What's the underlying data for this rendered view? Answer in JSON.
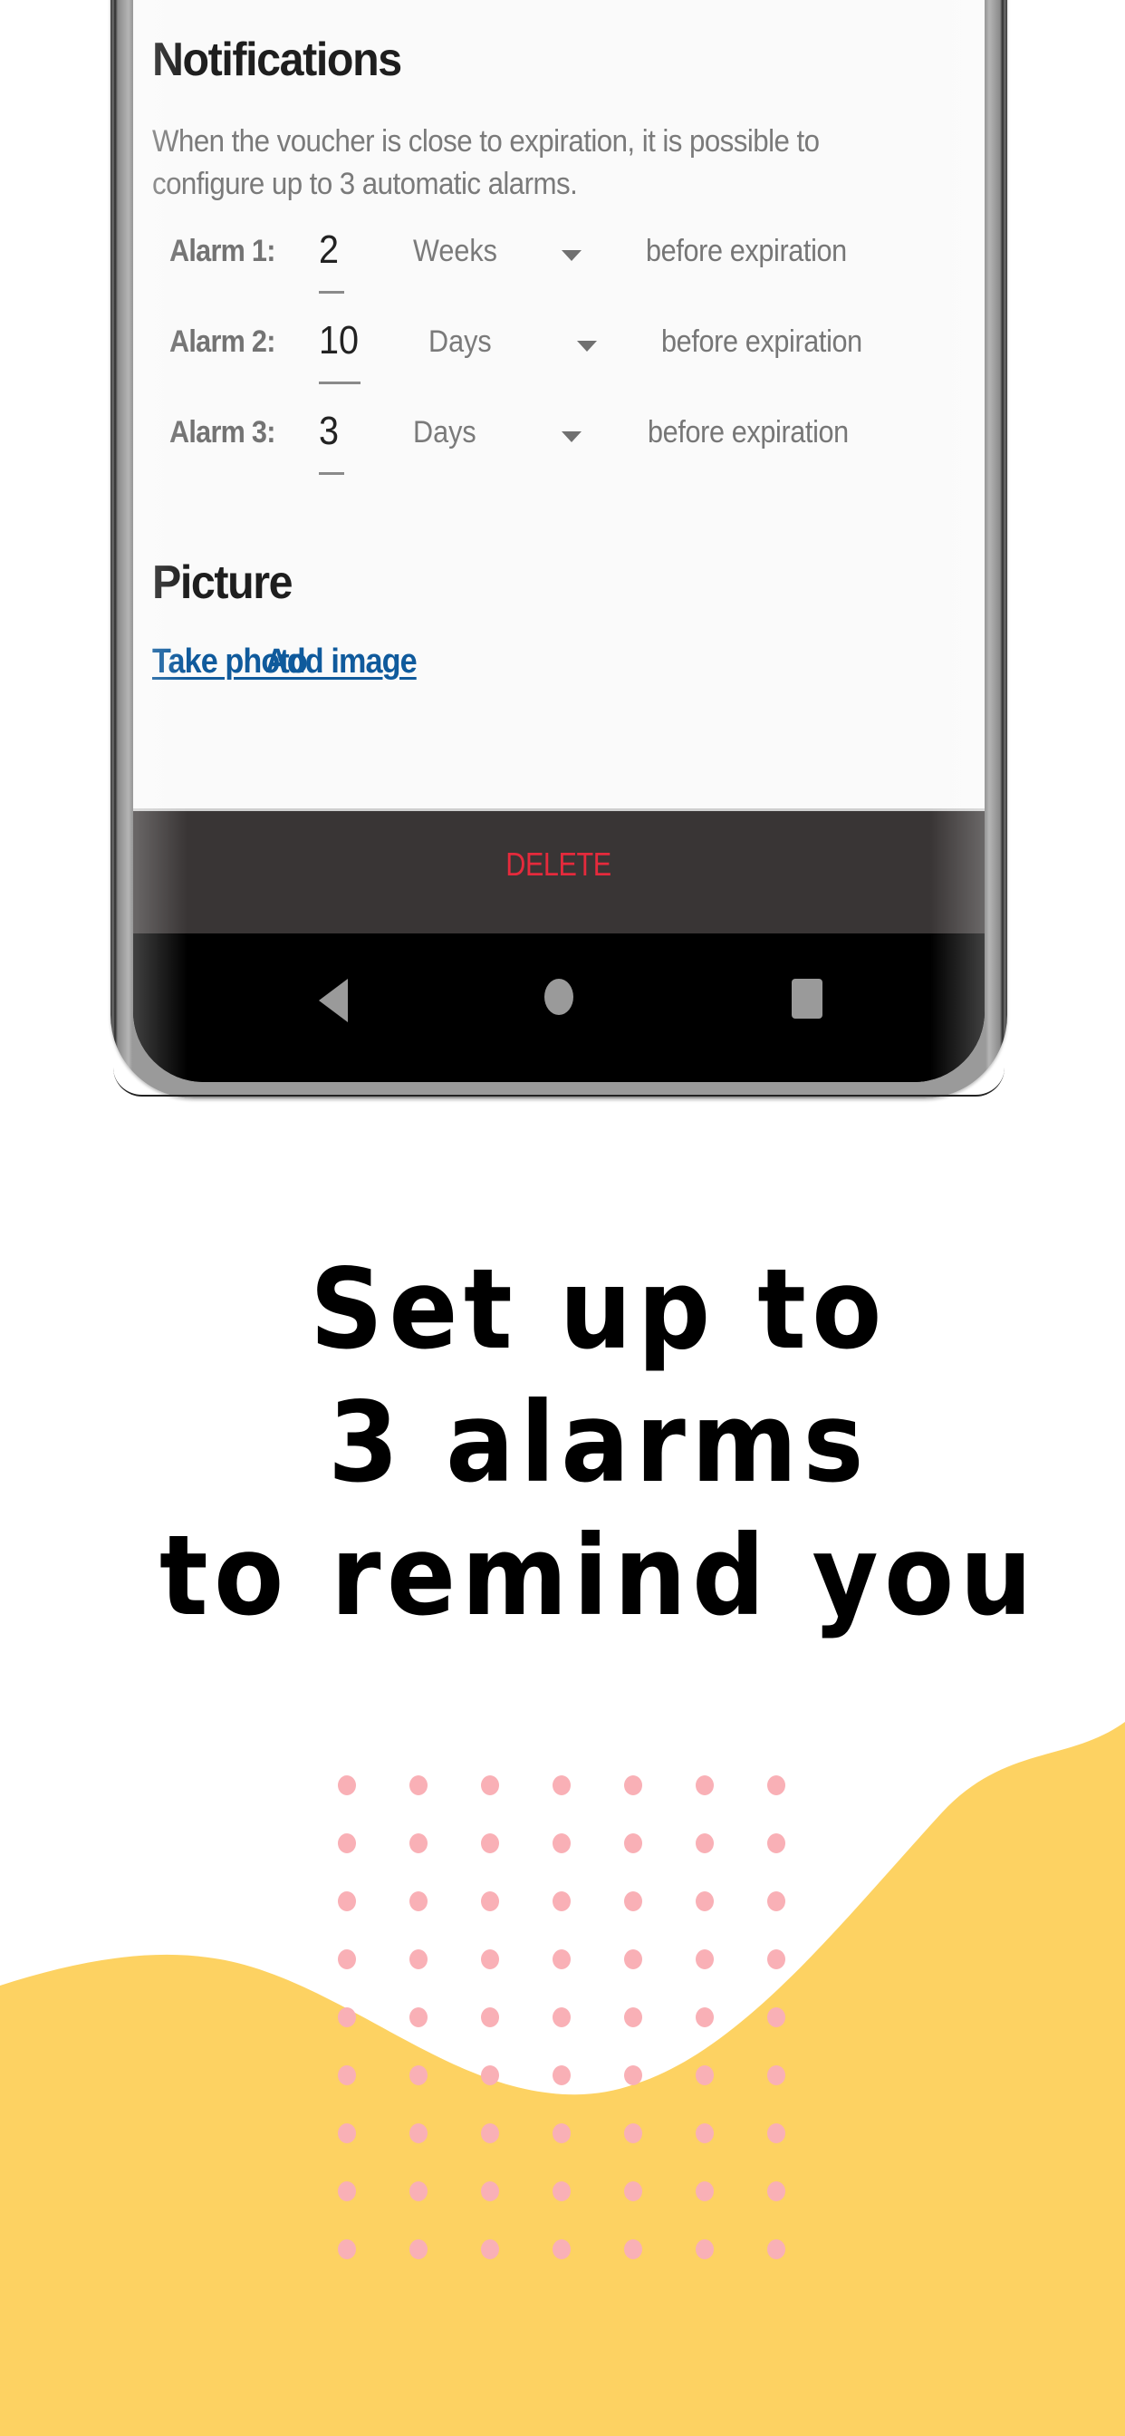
{
  "screen": {
    "notifications": {
      "title": "Notifications",
      "description_line1": "When the voucher is close to expiration, it is possible to",
      "description_line2": "configure up to 3 automatic alarms."
    },
    "alarms": [
      {
        "label": "Alarm 1:",
        "value": "2",
        "unit": "Weeks",
        "suffix": "before expiration"
      },
      {
        "label": "Alarm 2:",
        "value": "10",
        "unit": "Days",
        "suffix": "before expiration"
      },
      {
        "label": "Alarm 3:",
        "value": "3",
        "unit": "Days",
        "suffix": "before expiration"
      }
    ],
    "picture": {
      "title": "Picture",
      "take_photo_label": "Take photo",
      "add_image_label": "Add image"
    },
    "action_bar": {
      "delete_label": "DELETE"
    },
    "nav_bar": {
      "back_icon": "back-triangle-icon",
      "home_icon": "home-circle-icon",
      "recent_icon": "recent-apps-square-icon"
    }
  },
  "headline": {
    "line1": "Set up to",
    "line2": "3 alarms",
    "line3": "to remind you"
  },
  "colors": {
    "link": "#0f5a9c",
    "delete": "#e52a3c",
    "action_bar": "#393535",
    "wave": "#fdd262",
    "dots": "#f9b0b6"
  }
}
